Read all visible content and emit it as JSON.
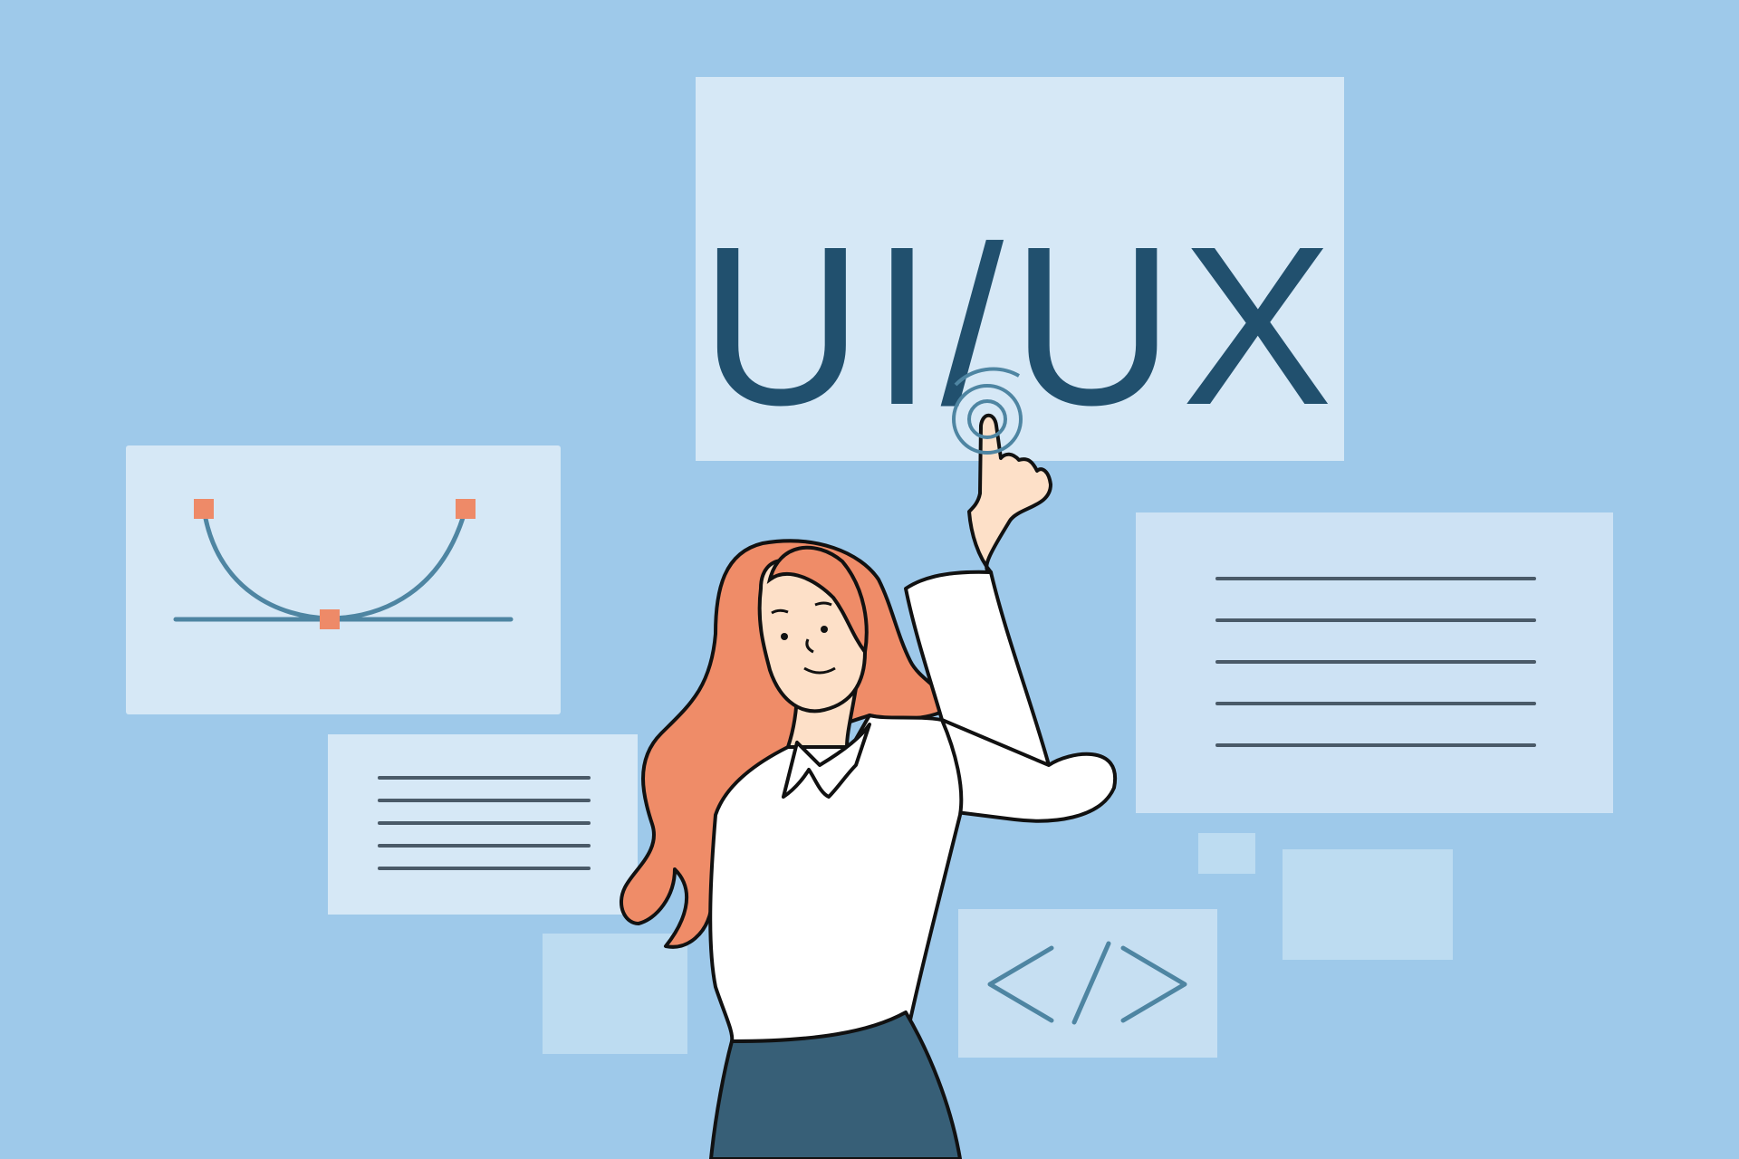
{
  "headline": {
    "text": "UI/UX"
  },
  "colors": {
    "background": "#9ec9ea",
    "panel": "#d6e8f6",
    "headline_text": "#21506e",
    "accent_orange": "#ee8a68",
    "curve_stroke": "#4e85a2",
    "hair": "#ef8c68",
    "skin": "#fde0c8",
    "skirt": "#375f77",
    "outline": "#111111"
  },
  "icons": {
    "curve_panel": "bezier-curve-icon",
    "code_panel": "code-brackets-icon",
    "tap": "tap-ripple-icon"
  }
}
